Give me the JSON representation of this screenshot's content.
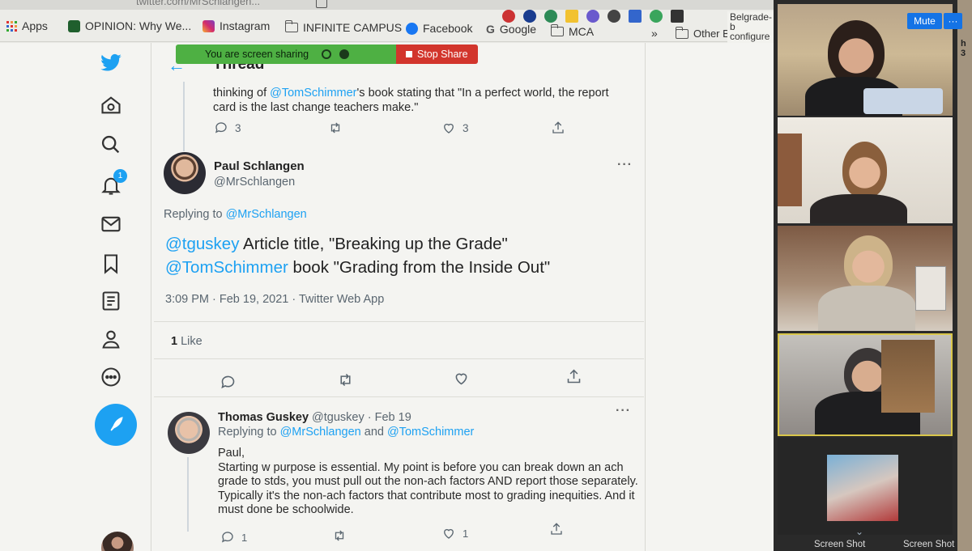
{
  "browser": {
    "url_fragment": "twitter.com/MrSchlangen...",
    "bookmarks": [
      {
        "label": "Apps",
        "icon": "apps-grid-icon"
      },
      {
        "label": "OPINION: Why We...",
        "icon": "opinion-icon"
      },
      {
        "label": "Instagram",
        "icon": "instagram-icon"
      },
      {
        "label": "INFINITE CAMPUS",
        "icon": "folder-icon"
      },
      {
        "label": "Facebook",
        "icon": "facebook-icon"
      },
      {
        "label": "Google",
        "icon": "google-icon"
      },
      {
        "label": "MCA",
        "icon": "folder-icon"
      },
      {
        "label": "»",
        "icon": ""
      },
      {
        "label": "Other Bookmarks",
        "icon": "folder-icon"
      }
    ],
    "popup_text": "Belgrade-b configure y"
  },
  "share_banner": {
    "status": "You are screen sharing",
    "stop_label": "Stop Share"
  },
  "twitter": {
    "header_title": "Thread",
    "notification_count": "1",
    "previous_tweet": {
      "text_a": "thinking of ",
      "mention": "@TomSchimmer",
      "text_b": "'s book stating that \"In a perfect world, the report card is the last change teachers make.\"",
      "replies": "3",
      "likes": "3"
    },
    "main_tweet": {
      "author_name": "Paul Schlangen",
      "author_handle": "@MrSchlangen",
      "replying_prefix": "Replying to ",
      "replying_handle": "@MrSchlangen",
      "mention1": "@tguskey",
      "text1": " Article title, \"Breaking up the Grade\"",
      "mention2": "@TomSchimmer",
      "text2": " book \"Grading from the Inside Out\"",
      "timestamp": "3:09 PM · Feb 19, 2021 · Twitter Web App",
      "like_count": "1",
      "like_label": " Like"
    },
    "reply_tweet": {
      "author_name": "Thomas Guskey",
      "author_handle": "@tguskey · Feb 19",
      "replying_prefix": "Replying to ",
      "replying_handle1": "@MrSchlangen",
      "replying_and": " and ",
      "replying_handle2": "@TomSchimmer",
      "body_line1": "Paul,",
      "body_line2": "Starting w purpose is essential. My point is before you can break down an ach grade to stds, you must pull out the non-ach factors AND report those separately. Typically it's the non-ach factors that contribute most to grading inequities. And it must done be schoolwide.",
      "replies": "1",
      "likes": "1"
    }
  },
  "zoom": {
    "mute_label": "Mute",
    "more_label": "···",
    "screen_shot_1": "Screen Shot",
    "screen_shot_2": "Screen Shot",
    "edge_letters": [
      "h",
      "3"
    ]
  },
  "colors": {
    "twitter_blue": "#1da1f2",
    "share_green": "#4eb043",
    "share_red": "#d2352c",
    "zoom_blue": "#1473e6"
  }
}
